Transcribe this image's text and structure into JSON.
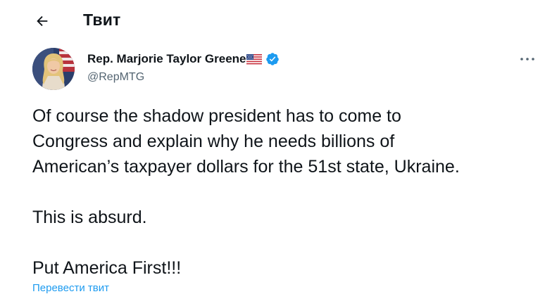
{
  "header": {
    "title": "Твит"
  },
  "tweet": {
    "author": {
      "display_name": "Rep. Marjorie Taylor Greene",
      "handle": "@RepMTG",
      "verified": true
    },
    "text_lines": [
      "Of course the shadow president has to come to",
      "Congress and explain why he needs billions of",
      "American’s taxpayer dollars for the 51st state, Ukraine."
    ],
    "text_paragraph_2": "This is absurd.",
    "text_paragraph_3": "Put America First!!!",
    "translate_label": "Перевести твит"
  },
  "icons": {
    "back": "arrow-left-icon",
    "verified": "verified-badge-icon",
    "flag": "us-flag-emoji",
    "more": "more-horizontal-icon"
  },
  "colors": {
    "link": "#1d9bf0",
    "verified": "#1d9bf0",
    "secondary_text": "#536471",
    "primary_text": "#0f1419"
  }
}
